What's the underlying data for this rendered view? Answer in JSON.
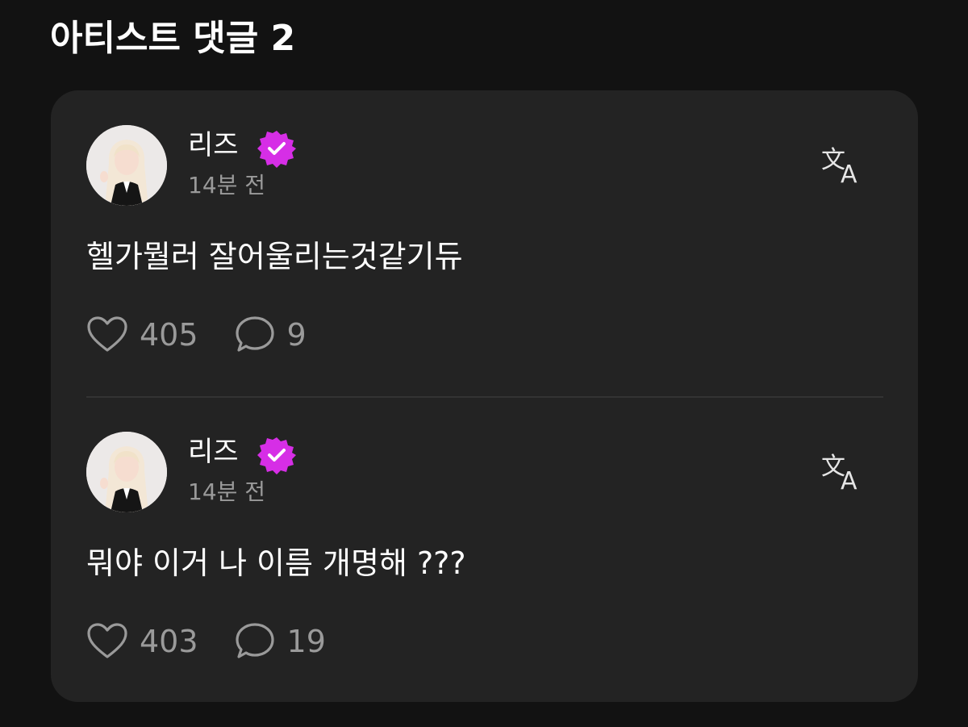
{
  "section": {
    "title": "아티스트 댓글 2"
  },
  "colors": {
    "background": "#121212",
    "card": "#232323",
    "verified_badge": "#d62ee6",
    "muted_text": "#9a9a9a"
  },
  "comments": [
    {
      "author": "리즈",
      "verified": true,
      "avatar_icon": "avatar-photo",
      "time": "14분 전",
      "text": "헬가뭘러 잘어울리는것같기듀",
      "likes": "405",
      "replies": "9",
      "like_icon": "heart-icon",
      "reply_icon": "speech-bubble-icon",
      "translate_icon": "translate-icon"
    },
    {
      "author": "리즈",
      "verified": true,
      "avatar_icon": "avatar-photo",
      "time": "14분 전",
      "text": "뭐야 이거 나 이름 개명해 ???",
      "likes": "403",
      "replies": "19",
      "like_icon": "heart-icon",
      "reply_icon": "speech-bubble-icon",
      "translate_icon": "translate-icon"
    }
  ]
}
